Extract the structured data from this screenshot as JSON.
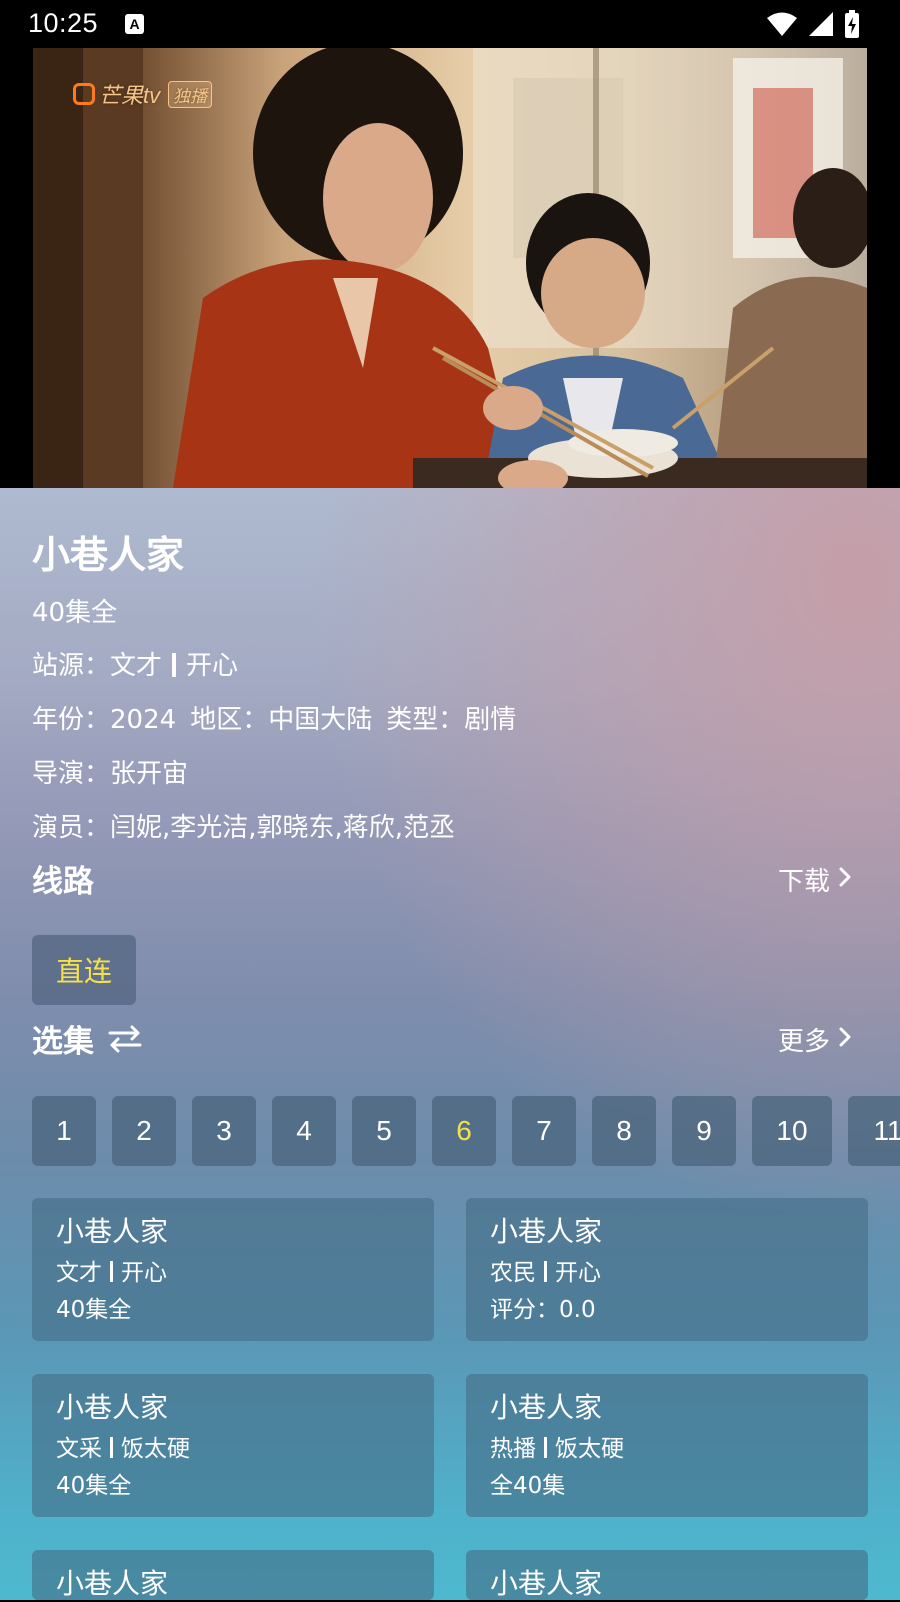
{
  "status_bar": {
    "time": "10:25",
    "notification_icon": "A"
  },
  "video": {
    "logo_text": "芒果tv",
    "logo_badge": "独播"
  },
  "detail": {
    "title": "小巷人家",
    "remark": "40集全",
    "site_label": "站源：",
    "site_name": "文才",
    "site_category": "开心",
    "year_label": "年份：",
    "year": "2024",
    "area_label": "地区：",
    "area": "中国大陆",
    "type_label": "类型：",
    "type": "剧情",
    "director_label": "导演：",
    "director": "张开宙",
    "actor_label": "演员：",
    "actors": "闫妮,李光洁,郭晓东,蒋欣,范丞"
  },
  "routes": {
    "title": "线路",
    "action": "下载",
    "items": [
      "直连"
    ]
  },
  "episodes": {
    "title": "选集",
    "action": "更多",
    "active_index": 5,
    "items": [
      "1",
      "2",
      "3",
      "4",
      "5",
      "6",
      "7",
      "8",
      "9",
      "10",
      "11"
    ]
  },
  "results": [
    {
      "title": "小巷人家",
      "source": "文才",
      "category": "开心",
      "remark": "40集全"
    },
    {
      "title": "小巷人家",
      "source": "农民",
      "category": "开心",
      "remark": "评分：0.0"
    },
    {
      "title": "小巷人家",
      "source": "文采",
      "category": "饭太硬",
      "remark": "40集全"
    },
    {
      "title": "小巷人家",
      "source": "热播",
      "category": "饭太硬",
      "remark": "全40集"
    },
    {
      "title": "小巷人家",
      "source": "",
      "category": "",
      "remark": ""
    },
    {
      "title": "小巷人家",
      "source": "",
      "category": "",
      "remark": ""
    }
  ],
  "colors": {
    "accent_yellow": "#f5e04a",
    "chip_bg": "#48627a",
    "gradient_top": "#aebad0",
    "gradient_bottom": "#4db9cf"
  },
  "icons": {
    "status": [
      "wifi-icon",
      "signal-icon",
      "battery-charging-icon"
    ],
    "download": "chevron-right-icon",
    "more": "chevron-right-icon",
    "swap": "swap-order-icon"
  }
}
